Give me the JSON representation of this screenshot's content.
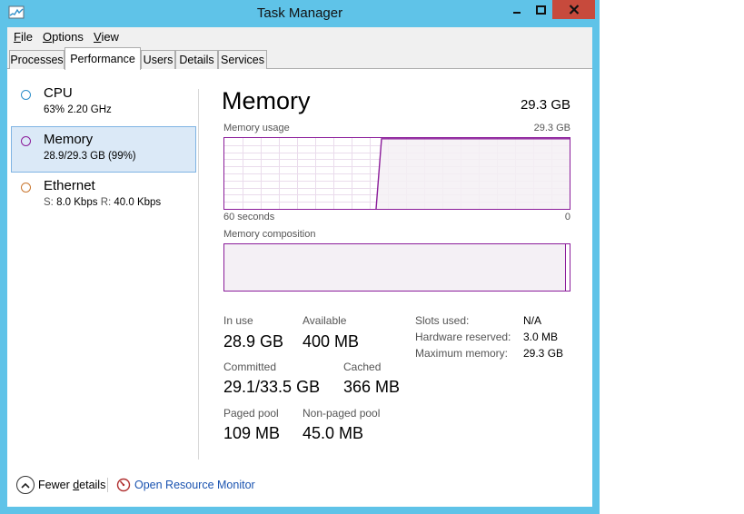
{
  "window": {
    "title": "Task Manager",
    "accent_color": "#5fc3e8",
    "close_color": "#c74a3c",
    "icons": {
      "app": "task-manager-icon",
      "minimize": "minimize-icon",
      "maximize": "maximize-icon",
      "close": "close-icon"
    }
  },
  "menu": {
    "items": [
      {
        "label": "File",
        "access_key": "F",
        "rest": "ile"
      },
      {
        "label": "Options",
        "access_key": "O",
        "rest": "ptions"
      },
      {
        "label": "View",
        "access_key": "V",
        "rest": "iew"
      }
    ]
  },
  "tabs": [
    {
      "label": "Processes",
      "active": false
    },
    {
      "label": "Performance",
      "active": true
    },
    {
      "label": "Users",
      "active": false
    },
    {
      "label": "Details",
      "active": false
    },
    {
      "label": "Services",
      "active": false
    }
  ],
  "sidebar": {
    "items": [
      {
        "title": "CPU",
        "subtitle": "63%  2.20 GHz",
        "color": "#2e8fc9",
        "selected": false
      },
      {
        "title": "Memory",
        "subtitle": "28.9/29.3 GB (99%)",
        "color": "#8b1c9a",
        "selected": true
      },
      {
        "title": "Ethernet",
        "subtitle_parts": [
          "S:",
          "8.0 Kbps",
          "R:",
          "40.0 Kbps"
        ],
        "color": "#c9762e",
        "selected": false
      }
    ]
  },
  "main": {
    "title": "Memory",
    "total": "29.3 GB",
    "usage_graph": {
      "label": "Memory usage",
      "max_label": "29.3 GB",
      "time_left": "60 seconds",
      "time_right": "0",
      "line_color": "#8b1c9a",
      "fill_color": "#f4f0f5",
      "usage_fraction": 0.99
    },
    "composition": {
      "label": "Memory composition",
      "in_use_fraction": 0.986
    },
    "stats": {
      "in_use_label": "In use",
      "in_use_value": "28.9 GB",
      "available_label": "Available",
      "available_value": "400 MB",
      "committed_label": "Committed",
      "committed_value": "29.1/33.5 GB",
      "cached_label": "Cached",
      "cached_value": "366 MB",
      "paged_pool_label": "Paged pool",
      "paged_pool_value": "109 MB",
      "non_paged_pool_label": "Non-paged pool",
      "non_paged_pool_value": "45.0 MB"
    },
    "specs": [
      {
        "label": "Slots used:",
        "value": "N/A"
      },
      {
        "label": "Hardware reserved:",
        "value": "3.0 MB"
      },
      {
        "label": "Maximum memory:",
        "value": "29.3 GB"
      }
    ]
  },
  "footer": {
    "fewer_details": {
      "before": "Fewer ",
      "access_key": "d",
      "after": "etails"
    },
    "resource_monitor": "Open Resource Monitor",
    "icons": {
      "fewer": "chevron-up-icon",
      "resmon": "resource-monitor-icon"
    }
  }
}
